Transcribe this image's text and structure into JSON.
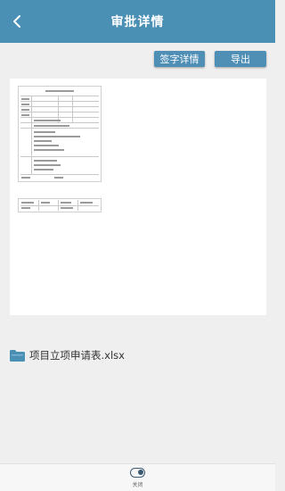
{
  "header": {
    "title": "审批详情"
  },
  "actions": {
    "sign_label": "签字详情",
    "export_label": "导出"
  },
  "file": {
    "name": "项目立项申请表.xlsx"
  },
  "bottom": {
    "close_label": "关闭"
  },
  "colors": {
    "header_bg": "#4a8fb4",
    "button_bg": "#4f8fb6",
    "page_bg": "#efefef"
  },
  "icons": {
    "back": "chevron-left-icon",
    "file": "folder-icon",
    "close": "toggle-icon"
  }
}
